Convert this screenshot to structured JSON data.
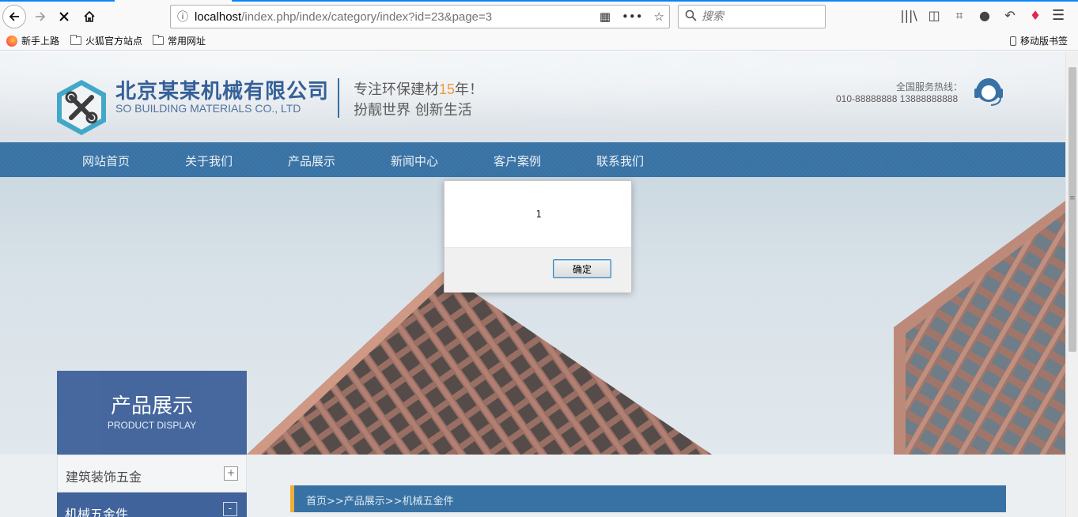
{
  "browser": {
    "url_host": "localhost",
    "url_path": "/index.php/index/category/index?id=23&page=3",
    "search_placeholder": "搜索",
    "bookmarks": {
      "firefox_start": "新手上路",
      "firefox_official": "火狐官方站点",
      "common_sites": "常用网址",
      "mobile": "移动版书签"
    }
  },
  "site": {
    "company_name": "北京某某机械有限公司",
    "company_en": "SO BUILDING MATERIALS CO., LTD",
    "slogan_prefix": "专注环保建材",
    "slogan_years": "15",
    "slogan_suffix": "年！",
    "slogan2": "扮靓世界 创新生活",
    "hotline_label": "全国服务热线：",
    "hotline_numbers": "010-88888888 13888888888",
    "nav": [
      "网站首页",
      "关于我们",
      "产品展示",
      "新闻中心",
      "客户案例",
      "联系我们"
    ],
    "side_title": "产品展示",
    "side_subtitle": "PRODUCT DISPLAY",
    "side_menu": [
      {
        "label": "建筑装饰五金",
        "toggle": "+"
      },
      {
        "label": "机械五金件",
        "toggle": "-"
      }
    ],
    "breadcrumb": "首页>>产品展示>>机械五金件"
  },
  "dialog": {
    "message": "1",
    "ok_label": "确定"
  },
  "colors": {
    "nav_blue": "#1d5f98",
    "side_blue": "#254e8d",
    "accent_orange": "#f08b1d"
  }
}
